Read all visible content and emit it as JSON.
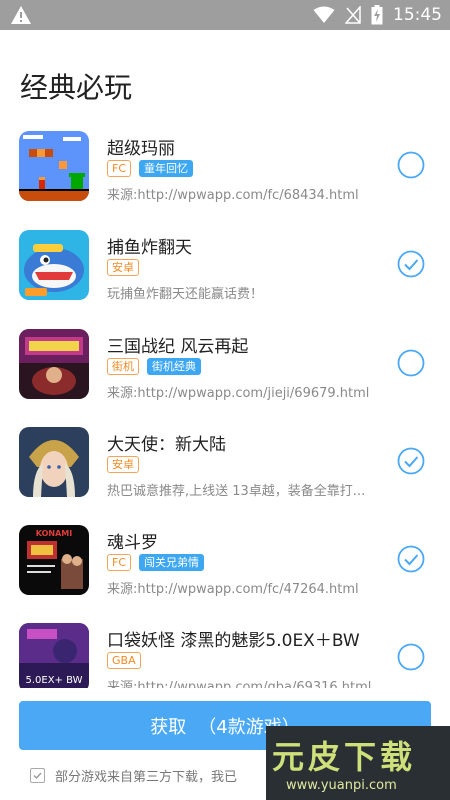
{
  "status": {
    "time": "15:45"
  },
  "page": {
    "title": "经典必玩"
  },
  "games": [
    {
      "name": "超级玛丽",
      "tags": [
        {
          "text": "FC",
          "style": "orange"
        },
        {
          "text": "童年回忆",
          "style": "blue"
        }
      ],
      "desc": "来源:http://wpwapp.com/fc/68434.html",
      "checked": false
    },
    {
      "name": "捕鱼炸翻天",
      "tags": [
        {
          "text": "安卓",
          "style": "orange"
        }
      ],
      "desc": "玩捕鱼炸翻天还能赢话费！",
      "checked": true
    },
    {
      "name": "三国战纪 风云再起",
      "tags": [
        {
          "text": "街机",
          "style": "orange"
        },
        {
          "text": "街机经典",
          "style": "blue"
        }
      ],
      "desc": "来源:http://wpwapp.com/jieji/69679.html",
      "checked": false
    },
    {
      "name": "大天使：新大陆",
      "tags": [
        {
          "text": "安卓",
          "style": "orange"
        }
      ],
      "desc": "热巴诚意推荐,上线送 13卓越，装备全靠打...",
      "checked": true
    },
    {
      "name": "魂斗罗",
      "tags": [
        {
          "text": "FC",
          "style": "orange"
        },
        {
          "text": "闯关兄弟情",
          "style": "blue"
        }
      ],
      "desc": "来源:http://wpwapp.com/fc/47264.html",
      "checked": true
    },
    {
      "name": "口袋妖怪 漆黑的魅影5.0EX＋BW",
      "tags": [
        {
          "text": "GBA",
          "style": "orange"
        }
      ],
      "desc": "来源:http://wpwapp.com/gba/69316.html",
      "checked": false
    }
  ],
  "thumbs": {
    "contra_logo": "KONAMI",
    "pokemon_caption": "5.0EX+ BW"
  },
  "action": {
    "label": "获取",
    "count": "（4款游戏）"
  },
  "agreement": {
    "text": "部分游戏来自第三方下载，我已"
  },
  "watermark": {
    "text": "元皮下载",
    "url": "www.yuanpi.com"
  },
  "colors": {
    "accent": "#4aa8f5",
    "tag_orange": "#f08a24",
    "tag_blue": "#3ea7f2"
  }
}
